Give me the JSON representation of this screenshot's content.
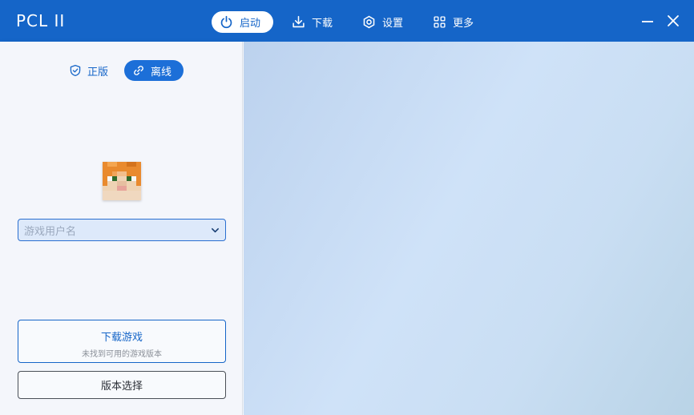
{
  "app": {
    "title": "PCL II"
  },
  "nav": {
    "launch": {
      "label": "启动",
      "icon": "power-icon"
    },
    "download": {
      "label": "下载",
      "icon": "download-icon"
    },
    "settings": {
      "label": "设置",
      "icon": "gear-icon"
    },
    "more": {
      "label": "更多",
      "icon": "grid-icon"
    }
  },
  "window": {
    "minimize_icon": "minimize-icon",
    "close_icon": "close-icon"
  },
  "login": {
    "official_label": "正版",
    "offline_label": "离线",
    "username_placeholder": "游戏用户名"
  },
  "actions": {
    "download_game_label": "下载游戏",
    "download_game_sub": "未找到可用的游戏版本",
    "version_select_label": "版本选择"
  },
  "colors": {
    "accent": "#1565c8",
    "panel": "#f4f6fb"
  }
}
